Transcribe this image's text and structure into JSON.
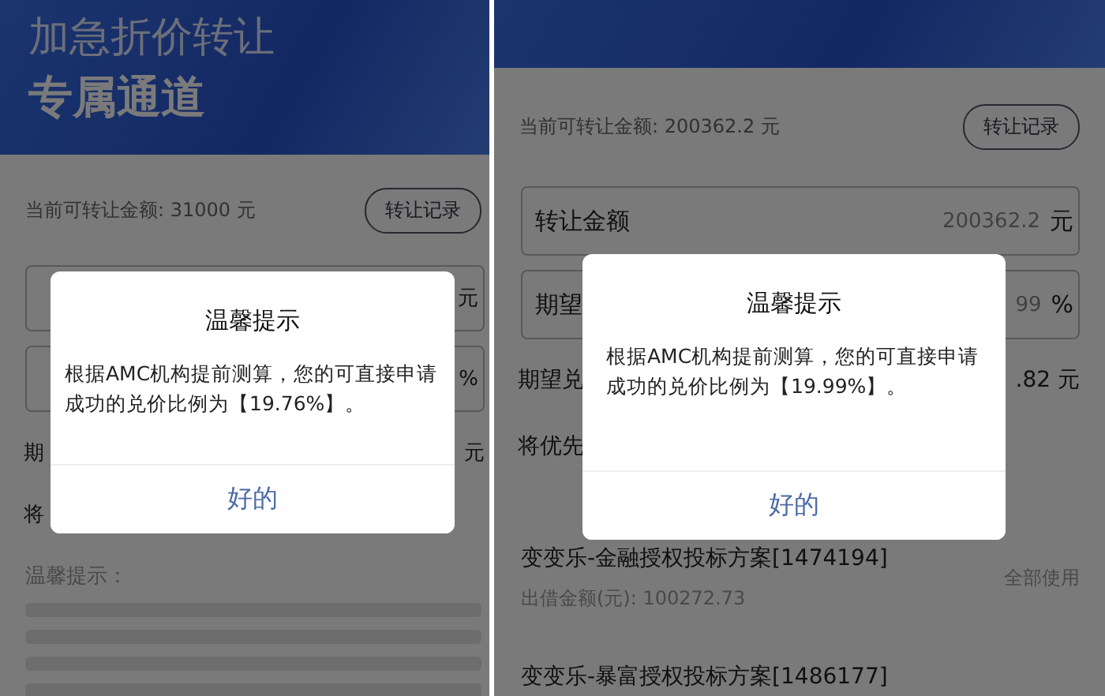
{
  "panels": [
    {
      "banner_lines": [
        "加急折价转让",
        "专属通道"
      ],
      "balance": "当前可转让金额: 31000 元",
      "record_button": "转让记录",
      "fields": [
        {
          "unit": "元"
        },
        {
          "unit": "%"
        }
      ],
      "rows": [
        {
          "label": "期",
          "value": "元"
        },
        {
          "label": "将"
        }
      ],
      "notes": {
        "title": "温馨提示："
      },
      "dialog": {
        "title": "温馨提示",
        "message": "根据AMC机构提前测算，您的可直接申请成功的兑价比例为【19.76%】。",
        "button": "好的"
      }
    },
    {
      "balance": "当前可转让金额: 200362.2 元",
      "record_button": "转让记录",
      "fields": [
        {
          "label": "转让金额",
          "value": "200362.2",
          "unit": "元"
        },
        {
          "label": "期望",
          "value": "99",
          "unit": "%"
        }
      ],
      "rows": [
        {
          "label": "期望兑",
          "value": ".82 元"
        },
        {
          "label": "将优先"
        }
      ],
      "plans": [
        {
          "title": "变变乐-金融授权投标方案[1474194]",
          "amount": "出借金额(元): 100272.73",
          "action": "全部使用"
        },
        {
          "title": "变变乐-暴富授权投标方案[1486177]"
        }
      ],
      "dialog": {
        "title": "温馨提示",
        "message": "根据AMC机构提前测算，您的可直接申请成功的兑价比例为【19.99%】。",
        "button": "好的"
      }
    }
  ]
}
